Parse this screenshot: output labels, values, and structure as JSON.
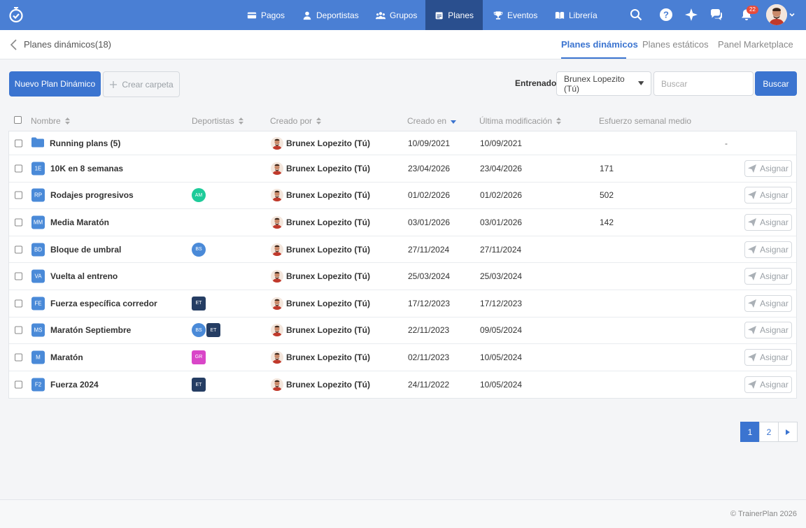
{
  "nav": {
    "items": [
      {
        "label": "Pagos",
        "icon": "card-icon"
      },
      {
        "label": "Deportistas",
        "icon": "user-icon"
      },
      {
        "label": "Grupos",
        "icon": "group-icon"
      },
      {
        "label": "Planes",
        "icon": "calendar-icon"
      },
      {
        "label": "Eventos",
        "icon": "trophy-icon"
      },
      {
        "label": "Librería",
        "icon": "book-icon"
      }
    ],
    "notifications_count": "22"
  },
  "subheader": {
    "title": "Planes dinámicos(18)",
    "tabs": [
      "Planes dinámicos",
      "Planes estáticos",
      "Panel Marketplace"
    ]
  },
  "toolbar": {
    "new_plan_label": "Nuevo Plan Dinámico",
    "create_folder_label": "Crear carpeta",
    "trainer_label": "Entrenador",
    "trainer_value": "Brunex Lopezito (Tú)",
    "search_placeholder": "Buscar",
    "search_button": "Buscar"
  },
  "table": {
    "headers": {
      "name": "Nombre",
      "athletes": "Deportistas",
      "created_by": "Creado por",
      "created_at": "Creado en",
      "modified": "Última modificación",
      "effort": "Esfuerzo semanal medio"
    },
    "assign_label": "Asignar",
    "folder": {
      "name": "Running plans (5)",
      "creator": "Brunex Lopezito (Tú)",
      "created": "10/09/2021",
      "modified": "10/09/2021",
      "effort": "-"
    },
    "rows": [
      {
        "chip": "1E",
        "name": "10K en 8 semanas",
        "athletes": [],
        "creator": "Brunex Lopezito (Tú)",
        "created": "23/04/2026",
        "modified": "23/04/2026",
        "effort": "171"
      },
      {
        "chip": "RP",
        "name": "Rodajes progresivos",
        "athletes": [
          {
            "initials": "AM",
            "color": "#1ecb9a",
            "shape": "circle"
          }
        ],
        "creator": "Brunex Lopezito (Tú)",
        "created": "01/02/2026",
        "modified": "01/02/2026",
        "effort": "502"
      },
      {
        "chip": "MM",
        "name": "Media Maratón",
        "athletes": [],
        "creator": "Brunex Lopezito (Tú)",
        "created": "03/01/2026",
        "modified": "03/01/2026",
        "effort": "142"
      },
      {
        "chip": "BD",
        "name": "Bloque de umbral",
        "athletes": [
          {
            "initials": "BS",
            "color": "#4a8ad8",
            "shape": "circle"
          }
        ],
        "creator": "Brunex Lopezito (Tú)",
        "created": "27/11/2024",
        "modified": "27/11/2024",
        "effort": ""
      },
      {
        "chip": "VA",
        "name": "Vuelta al entreno",
        "athletes": [],
        "creator": "Brunex Lopezito (Tú)",
        "created": "25/03/2024",
        "modified": "25/03/2024",
        "effort": ""
      },
      {
        "chip": "FE",
        "name": "Fuerza específica corredor",
        "athletes": [
          {
            "initials": "ET",
            "color": "#253d63",
            "shape": "square"
          }
        ],
        "creator": "Brunex Lopezito (Tú)",
        "created": "17/12/2023",
        "modified": "17/12/2023",
        "effort": ""
      },
      {
        "chip": "MS",
        "name": "Maratón Septiembre",
        "athletes": [
          {
            "initials": "BS",
            "color": "#4a8ad8",
            "shape": "circle"
          },
          {
            "initials": "ET",
            "color": "#253d63",
            "shape": "square"
          }
        ],
        "creator": "Brunex Lopezito (Tú)",
        "created": "22/11/2023",
        "modified": "09/05/2024",
        "effort": ""
      },
      {
        "chip": "M",
        "name": "Maratón",
        "athletes": [
          {
            "initials": "GR",
            "color": "#d946c8",
            "shape": "square"
          }
        ],
        "creator": "Brunex Lopezito (Tú)",
        "created": "02/11/2023",
        "modified": "10/05/2024",
        "effort": ""
      },
      {
        "chip": "F2",
        "name": "Fuerza 2024",
        "athletes": [
          {
            "initials": "ET",
            "color": "#253d63",
            "shape": "square"
          }
        ],
        "creator": "Brunex Lopezito (Tú)",
        "created": "24/11/2022",
        "modified": "10/05/2024",
        "effort": ""
      }
    ]
  },
  "pagination": {
    "pages": [
      "1",
      "2"
    ],
    "current": "1"
  },
  "footer": {
    "copyright": "© TrainerPlan 2026"
  },
  "colors": {
    "brand": "#4a7fd4",
    "nav_active": "#2a4f8e",
    "accent": "#3b74d0"
  }
}
